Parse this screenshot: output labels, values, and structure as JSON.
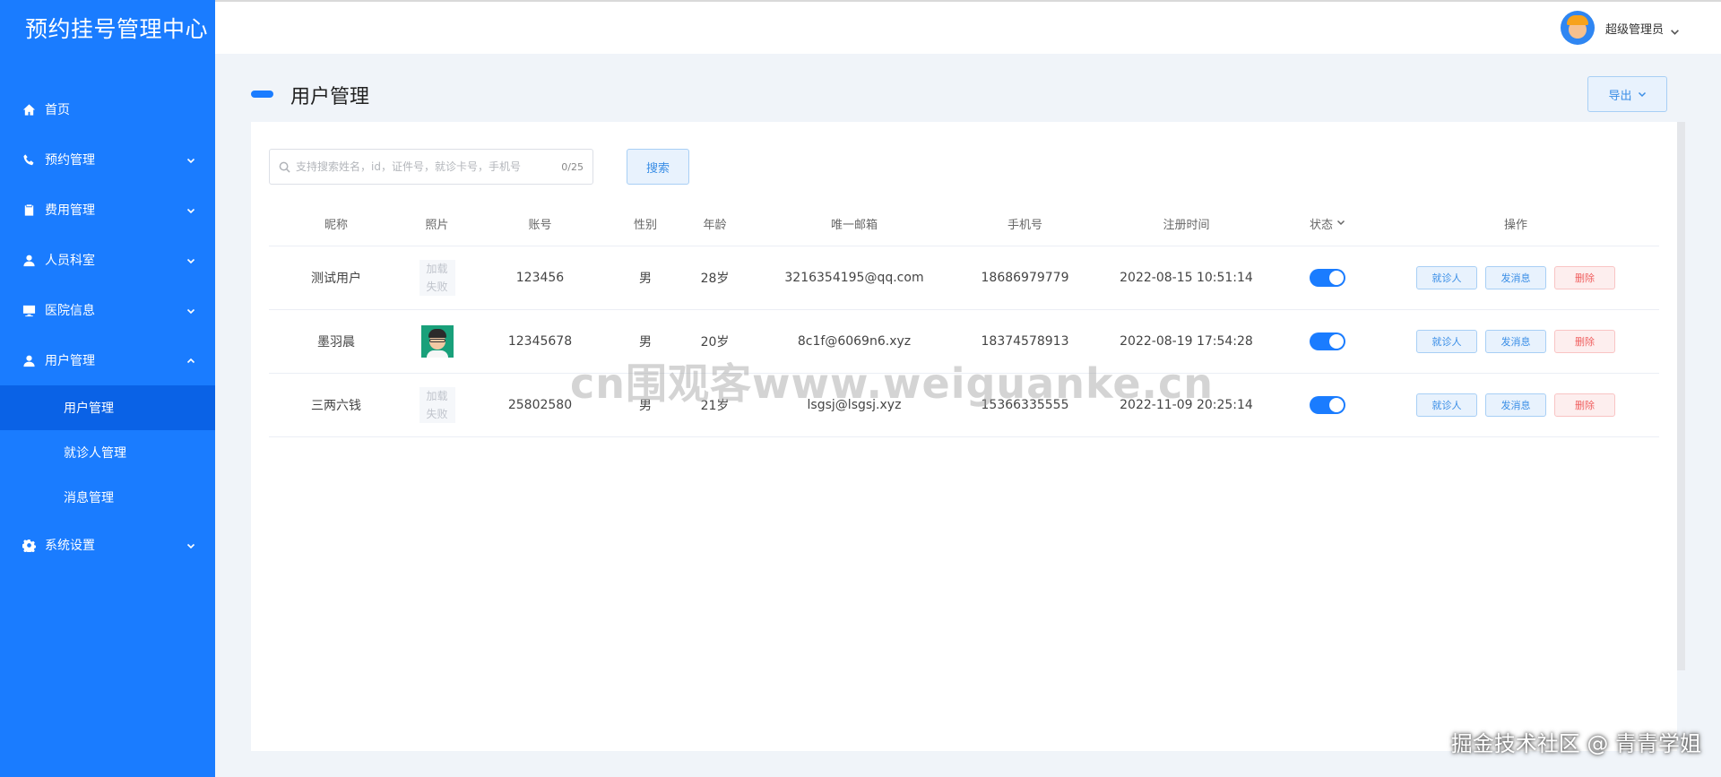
{
  "app": {
    "title": "预约挂号管理中心"
  },
  "sidebar": {
    "items": [
      {
        "label": "首页",
        "icon": "home-icon",
        "expandable": false
      },
      {
        "label": "预约管理",
        "icon": "phone-icon",
        "expandable": true
      },
      {
        "label": "费用管理",
        "icon": "clipboard-icon",
        "expandable": true
      },
      {
        "label": "人员科室",
        "icon": "user-icon",
        "expandable": true
      },
      {
        "label": "医院信息",
        "icon": "monitor-icon",
        "expandable": true
      },
      {
        "label": "用户管理",
        "icon": "user-icon",
        "expandable": true,
        "expanded": true
      },
      {
        "label": "系统设置",
        "icon": "gear-icon",
        "expandable": true
      }
    ],
    "submenu": [
      {
        "label": "用户管理",
        "active": true
      },
      {
        "label": "就诊人管理",
        "active": false
      },
      {
        "label": "消息管理",
        "active": false
      }
    ]
  },
  "header": {
    "user_name": "超级管理员"
  },
  "page": {
    "title": "用户管理",
    "export_label": "导出"
  },
  "search": {
    "placeholder": "支持搜索姓名，id，证件号，就诊卡号，手机号",
    "count": "0/25",
    "button_label": "搜索"
  },
  "table": {
    "columns": [
      "昵称",
      "照片",
      "账号",
      "性别",
      "年龄",
      "唯一邮箱",
      "手机号",
      "注册时间",
      "状态",
      "操作"
    ],
    "rows": [
      {
        "nickname": "测试用户",
        "photo": "加载失败",
        "photo_line1": "加载",
        "photo_line2": "失败",
        "account": "123456",
        "gender": "男",
        "age": "28岁",
        "email": "3216354195@qq.com",
        "phone": "18686979779",
        "registered": "2022-08-15 10:51:14",
        "status_on": true
      },
      {
        "nickname": "墨羽晨",
        "photo": "avatar",
        "account": "12345678",
        "gender": "男",
        "age": "20岁",
        "email": "8c1f@6069n6.xyz",
        "phone": "18374578913",
        "registered": "2022-08-19 17:54:28",
        "status_on": true
      },
      {
        "nickname": "三两六钱",
        "photo": "加载失败",
        "photo_line1": "加载",
        "photo_line2": "失败",
        "account": "25802580",
        "gender": "男",
        "age": "21岁",
        "email": "lsgsj@lsgsj.xyz",
        "phone": "15366335555",
        "registered": "2022-11-09 20:25:14",
        "status_on": true
      }
    ],
    "actions": {
      "visit_label": "就诊人",
      "message_label": "发消息",
      "delete_label": "删除"
    }
  },
  "overlay": {
    "watermark": "cn围观客www.weiguanke.cn",
    "corner_text": "掘金技术社区 @ 青青学姐"
  },
  "colors": {
    "sidebar": "#1a7cff",
    "active_submenu": "#0a62e6",
    "accent": "#1a7cff",
    "danger": "#f06060"
  }
}
